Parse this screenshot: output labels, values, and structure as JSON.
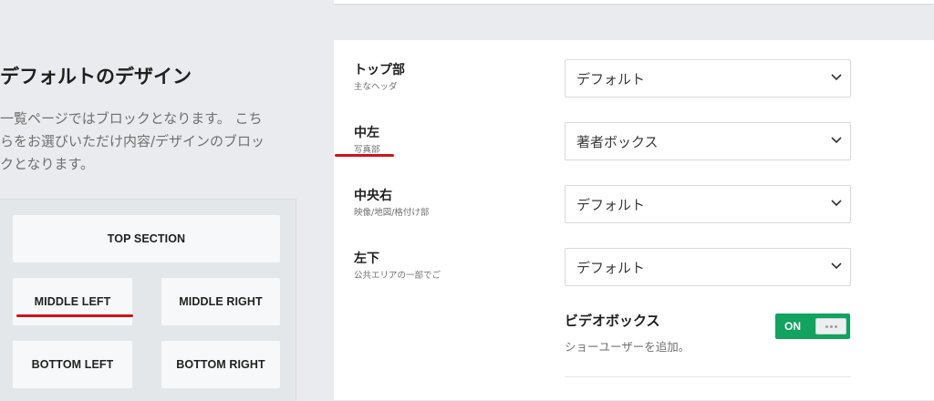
{
  "left": {
    "title": "デフォルトのデザイン",
    "description_lines": [
      "一覧ページではブロックとなります。 こち",
      "らをお選びいただけ内容/デザインのブロッ",
      "クとなります。"
    ],
    "blocks": {
      "top": "TOP SECTION",
      "middle_left": "MIDDLE LEFT",
      "middle_right": "MIDDLE RIGHT",
      "bottom_left": "BOTTOM LEFT",
      "bottom_right": "BOTTOM RIGHT"
    }
  },
  "settings": {
    "rows": [
      {
        "label": "トップ部",
        "sub": "主なヘッダ",
        "value": "デフォルト"
      },
      {
        "label": "中左",
        "sub": "写真部",
        "value": "著者ボックス"
      },
      {
        "label": "中央右",
        "sub": "映像/地図/格付け部",
        "value": "デフォルト"
      },
      {
        "label": "左下",
        "sub": "公共エリアの一部でご",
        "value": "デフォルト"
      }
    ],
    "video_box": {
      "title": "ビデオボックス",
      "description": "ショーユーザーを追加。",
      "toggle_label": "ON"
    }
  },
  "colors": {
    "accent_red": "#d0121b",
    "toggle_green": "#11a35f"
  }
}
